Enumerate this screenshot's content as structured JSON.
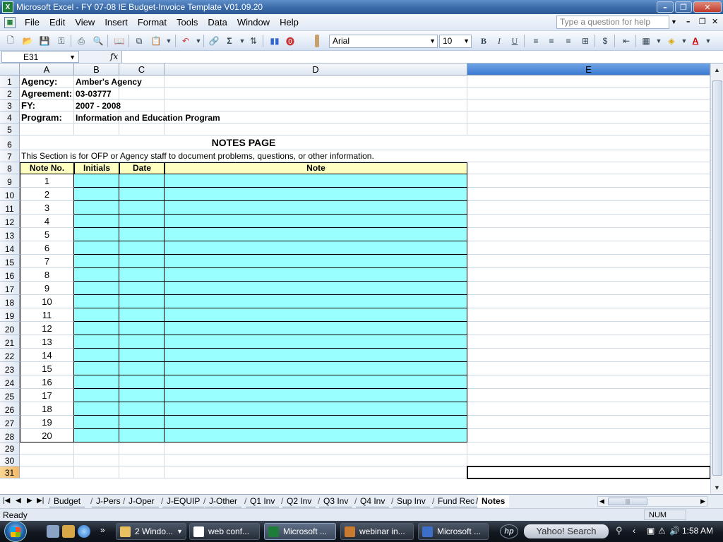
{
  "window": {
    "title": "Microsoft Excel - FY 07-08 IE Budget-Invoice Template V01.09.20",
    "app_icon": "X"
  },
  "menu": {
    "items": [
      "File",
      "Edit",
      "View",
      "Insert",
      "Format",
      "Tools",
      "Data",
      "Window",
      "Help"
    ],
    "help_placeholder": "Type a question for help"
  },
  "toolbar": {
    "font": "Arial",
    "size": "10",
    "sigma": "Σ",
    "bold": "B",
    "italic": "I",
    "underline": "U",
    "currency": "$",
    "font_color": "A"
  },
  "formula_bar": {
    "name_box": "E31",
    "fx": "fx",
    "content": ""
  },
  "columns": [
    "A",
    "B",
    "C",
    "D",
    "E"
  ],
  "rows": [
    "1",
    "2",
    "3",
    "4",
    "5",
    "6",
    "7",
    "8",
    "9",
    "10",
    "11",
    "12",
    "13",
    "14",
    "15",
    "16",
    "17",
    "18",
    "19",
    "20",
    "21",
    "22",
    "23",
    "24",
    "25",
    "26",
    "27",
    "28",
    "29",
    "30",
    "31"
  ],
  "sheet": {
    "agency_label": "Agency:",
    "agency_value": "Amber's Agency",
    "agreement_label": "Agreement:",
    "agreement_value": "03-03777",
    "fy_label": "FY:",
    "fy_value": "2007 - 2008",
    "program_label": "Program:",
    "program_value": "Information and Education Program",
    "page_title": "NOTES PAGE",
    "section_text": "This Section is for OFP or Agency staff to document problems, questions, or other information.",
    "table_headers": [
      "Note No.",
      "Initials",
      "Date",
      "Note"
    ],
    "note_numbers": [
      "1",
      "2",
      "3",
      "4",
      "5",
      "6",
      "7",
      "8",
      "9",
      "10",
      "11",
      "12",
      "13",
      "14",
      "15",
      "16",
      "17",
      "18",
      "19",
      "20"
    ]
  },
  "sheet_tabs": [
    "Budget",
    "J-Pers",
    "J-Oper",
    "J-EQUIP",
    "J-Other",
    "Q1 Inv",
    "Q2 Inv",
    "Q3 Inv",
    "Q4 Inv",
    "Sup Inv",
    "Fund Rec",
    "Notes"
  ],
  "active_tab": "Notes",
  "statusbar": {
    "status": "Ready",
    "num": "NUM"
  },
  "taskbar": {
    "tasks": [
      "2 Windo...",
      "web conf...",
      "Microsoft ...",
      "webinar in...",
      "Microsoft ..."
    ],
    "search_label": "Yahoo! Search",
    "clock": "1:58 AM",
    "hp_logo": "hp"
  },
  "colors": {
    "note_fill": "#99ffff",
    "header_fill": "#ffffc0",
    "title_bar": "#3a6aa8"
  }
}
